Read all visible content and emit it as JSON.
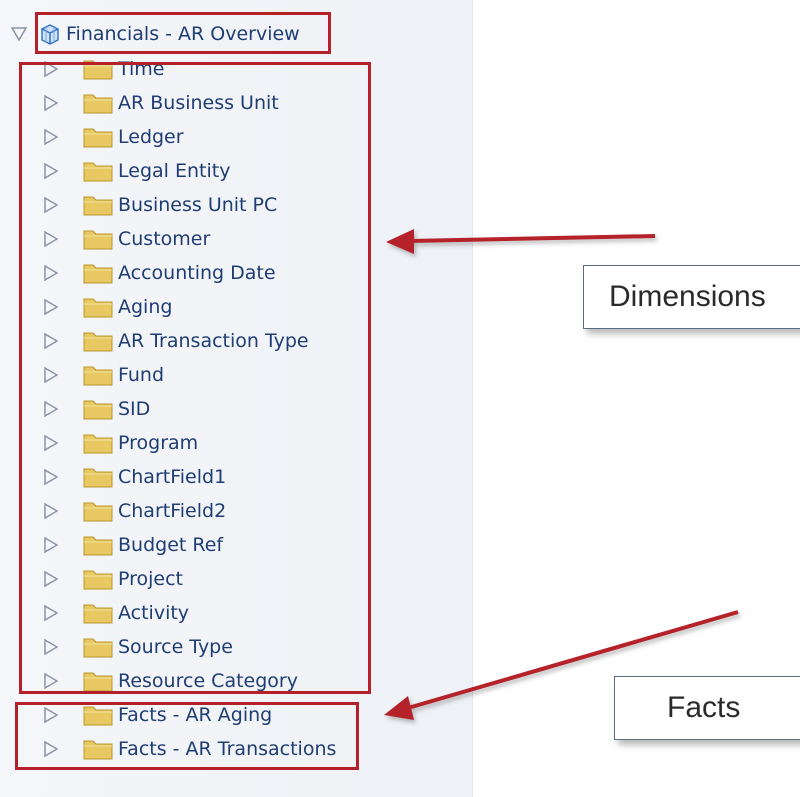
{
  "tree": {
    "root": {
      "label": "Financials - AR Overview",
      "expanded": true,
      "icon": "cube-icon"
    },
    "dimensions": [
      "Time",
      "AR Business Unit",
      "Ledger",
      "Legal Entity",
      "Business Unit PC",
      "Customer",
      "Accounting Date",
      "Aging",
      "AR Transaction Type",
      "Fund",
      "SID",
      "Program",
      "ChartField1",
      "ChartField2",
      "Budget Ref",
      "Project",
      "Activity",
      "Source Type",
      "Resource Category"
    ],
    "facts": [
      "Facts - AR Aging",
      "Facts - AR Transactions"
    ]
  },
  "callouts": {
    "dimensions_label": "Dimensions",
    "facts_label": "Facts"
  },
  "colors": {
    "highlight": "#b5212a",
    "link_text": "#1f3d73",
    "folder": "#e8c862"
  }
}
